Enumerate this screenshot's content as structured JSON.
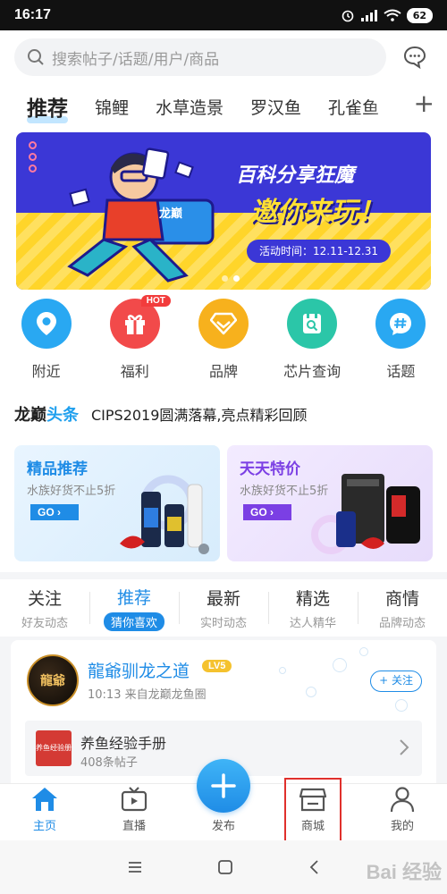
{
  "status_bar": {
    "time": "16:17",
    "battery": "62"
  },
  "search": {
    "placeholder": "搜索帖子/话题/用户/商品"
  },
  "category_tabs": [
    "推荐",
    "锦鲤",
    "水草造景",
    "罗汉鱼",
    "孔雀鱼"
  ],
  "banner": {
    "title": "百科分享狂魔",
    "slogan": "邀你来玩！",
    "date": "活动时间：12.11-12.31",
    "badge_text": "龙巅"
  },
  "quick_links": [
    {
      "label": "附近",
      "icon": "location-icon",
      "color": "#29a8f2"
    },
    {
      "label": "福利",
      "icon": "gift-icon",
      "color": "#f24a4a",
      "badge": "HOT"
    },
    {
      "label": "品牌",
      "icon": "diamond-icon",
      "color": "#f7b11d"
    },
    {
      "label": "芯片查询",
      "icon": "chip-search-icon",
      "color": "#2bc6a8"
    },
    {
      "label": "话题",
      "icon": "hashtag-icon",
      "color": "#29a8f2"
    }
  ],
  "headline": {
    "logo_a": "龙巅",
    "logo_b": "头条",
    "text": "CIPS2019圆满落幕,亮点精彩回顾"
  },
  "promos": [
    {
      "title": "精品推荐",
      "subtitle": "水族好货不止5折",
      "button": "GO"
    },
    {
      "title": "天天特价",
      "subtitle": "水族好货不止5折",
      "button": "GO"
    }
  ],
  "feed_tabs": [
    {
      "title": "关注",
      "subtitle": "好友动态"
    },
    {
      "title": "推荐",
      "subtitle": "猜你喜欢",
      "active": true
    },
    {
      "title": "最新",
      "subtitle": "实时动态"
    },
    {
      "title": "精选",
      "subtitle": "达人精华"
    },
    {
      "title": "商情",
      "subtitle": "品牌动态"
    }
  ],
  "post": {
    "avatar_text": "龍爺",
    "author": "龍爺驯龙之道",
    "level": "LV5",
    "meta": "10:13  来自龙巅龙鱼圈",
    "follow": "+ 关注",
    "link_thumb": "养鱼经验册",
    "link_title": "养鱼经验手册",
    "link_count": "408条帖子"
  },
  "bottom_nav": [
    {
      "label": "主页",
      "icon": "home-icon",
      "active": true
    },
    {
      "label": "直播",
      "icon": "tv-icon"
    },
    {
      "label": "发布",
      "icon": "plus-icon"
    },
    {
      "label": "商城",
      "icon": "store-icon",
      "highlighted": true
    },
    {
      "label": "我的",
      "icon": "person-icon"
    }
  ],
  "watermark": "Bai 经验",
  "colors": {
    "accent": "#1f8ce6",
    "highlight": "#e0302c"
  }
}
